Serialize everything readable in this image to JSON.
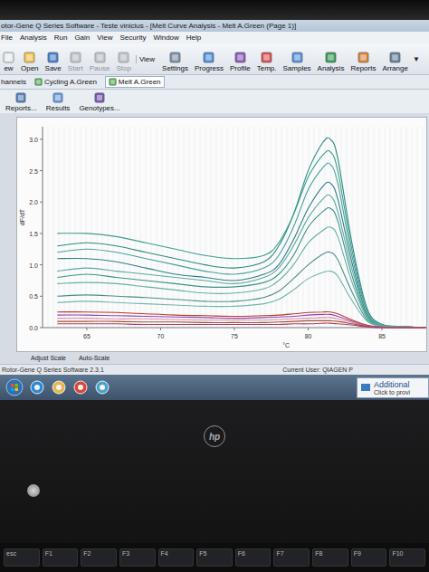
{
  "window": {
    "title": "otor-Gene Q Series Software - Teste vinicius - [Melt Curve Analysis - Melt A.Green (Page 1)]"
  },
  "menu": [
    "File",
    "Analysis",
    "Run",
    "Gain",
    "View",
    "Security",
    "Window",
    "Help"
  ],
  "toolbar": {
    "file_buttons": [
      {
        "label": "ew",
        "disabled": false
      },
      {
        "label": "Open",
        "disabled": false
      },
      {
        "label": "Save",
        "disabled": false
      },
      {
        "label": "Start",
        "disabled": true
      },
      {
        "label": "Pause",
        "disabled": true
      },
      {
        "label": "Stop",
        "disabled": true
      }
    ],
    "view_label": "View",
    "view_buttons": [
      "Settings",
      "Progress",
      "Profile",
      "Temp.",
      "Samples",
      "Analysis",
      "Reports",
      "Arrange"
    ],
    "more": "▼"
  },
  "channels": {
    "label": "hannels",
    "tabs": [
      {
        "label": "Cycling A.Green",
        "selected": false
      },
      {
        "label": "Melt A.Green",
        "selected": true
      }
    ]
  },
  "analysis_bar": [
    "Reports...",
    "Results",
    "Genotypes..."
  ],
  "chart": {
    "y_label": "dF/dT",
    "y_ticks": [
      "3.0",
      "2.5",
      "2.0",
      "1.5",
      "1.0",
      "0.5",
      "0.0"
    ],
    "x_ticks": [
      "65",
      "70",
      "75",
      "80",
      "85"
    ],
    "x_unit": "°C",
    "temperatures": [
      63,
      65,
      67,
      69,
      71,
      73,
      75,
      77,
      78,
      79,
      80,
      81,
      81.5,
      82,
      83,
      84,
      85,
      86,
      88
    ],
    "series": [
      {
        "color": "#2e8b7e",
        "values": [
          1.3,
          1.35,
          1.3,
          1.2,
          1.1,
          1.0,
          0.95,
          1.05,
          1.3,
          1.8,
          2.5,
          2.95,
          3.0,
          2.7,
          1.3,
          0.3,
          0.05,
          0.02,
          0.0
        ]
      },
      {
        "color": "#3aa08f",
        "values": [
          1.5,
          1.5,
          1.45,
          1.35,
          1.25,
          1.15,
          1.1,
          1.15,
          1.35,
          1.8,
          2.4,
          2.75,
          2.8,
          2.5,
          1.2,
          0.25,
          0.05,
          0.02,
          0.0
        ]
      },
      {
        "color": "#4a9fa0",
        "values": [
          1.2,
          1.25,
          1.2,
          1.1,
          1.0,
          0.9,
          0.85,
          0.95,
          1.15,
          1.6,
          2.2,
          2.55,
          2.6,
          2.3,
          1.1,
          0.25,
          0.05,
          0.02,
          0.0
        ]
      },
      {
        "color": "#2f7f86",
        "values": [
          1.1,
          1.1,
          1.05,
          0.95,
          0.85,
          0.8,
          0.75,
          0.85,
          1.0,
          1.4,
          1.9,
          2.25,
          2.3,
          2.05,
          1.0,
          0.2,
          0.04,
          0.02,
          0.0
        ]
      },
      {
        "color": "#5aa9a0",
        "values": [
          0.9,
          0.95,
          0.9,
          0.85,
          0.8,
          0.75,
          0.7,
          0.8,
          0.95,
          1.3,
          1.75,
          2.05,
          2.1,
          1.85,
          0.9,
          0.2,
          0.04,
          0.02,
          0.0
        ]
      },
      {
        "color": "#3d9488",
        "values": [
          0.8,
          0.85,
          0.8,
          0.75,
          0.7,
          0.65,
          0.65,
          0.72,
          0.85,
          1.15,
          1.6,
          1.85,
          1.9,
          1.7,
          0.8,
          0.18,
          0.03,
          0.01,
          0.0
        ]
      },
      {
        "color": "#62b0a6",
        "values": [
          0.7,
          0.72,
          0.7,
          0.65,
          0.6,
          0.55,
          0.55,
          0.62,
          0.75,
          1.0,
          1.35,
          1.55,
          1.6,
          1.45,
          0.7,
          0.15,
          0.03,
          0.01,
          0.0
        ]
      },
      {
        "color": "#4b8f8a",
        "values": [
          0.5,
          0.52,
          0.5,
          0.48,
          0.45,
          0.42,
          0.42,
          0.48,
          0.58,
          0.78,
          1.0,
          1.17,
          1.2,
          1.08,
          0.55,
          0.12,
          0.02,
          0.01,
          0.0
        ]
      },
      {
        "color": "#70b7ad",
        "values": [
          0.4,
          0.42,
          0.4,
          0.38,
          0.36,
          0.34,
          0.34,
          0.38,
          0.45,
          0.6,
          0.78,
          0.88,
          0.9,
          0.82,
          0.42,
          0.1,
          0.02,
          0.01,
          0.0
        ]
      },
      {
        "color": "#c0392b",
        "values": [
          0.25,
          0.25,
          0.24,
          0.22,
          0.2,
          0.19,
          0.18,
          0.19,
          0.2,
          0.22,
          0.24,
          0.25,
          0.25,
          0.22,
          0.12,
          0.04,
          0.01,
          0.0,
          0.0
        ]
      },
      {
        "color": "#8e44ad",
        "values": [
          0.2,
          0.2,
          0.19,
          0.18,
          0.17,
          0.16,
          0.15,
          0.16,
          0.17,
          0.18,
          0.2,
          0.21,
          0.21,
          0.18,
          0.1,
          0.03,
          0.01,
          0.0,
          0.0
        ]
      },
      {
        "color": "#d98cb3",
        "values": [
          0.15,
          0.15,
          0.14,
          0.14,
          0.13,
          0.12,
          0.12,
          0.12,
          0.13,
          0.14,
          0.15,
          0.16,
          0.16,
          0.14,
          0.08,
          0.02,
          0.0,
          0.0,
          0.0
        ]
      },
      {
        "color": "#a0522d",
        "values": [
          0.1,
          0.1,
          0.1,
          0.09,
          0.09,
          0.08,
          0.08,
          0.08,
          0.09,
          0.1,
          0.11,
          0.11,
          0.11,
          0.1,
          0.06,
          0.02,
          0.0,
          0.0,
          0.0
        ]
      },
      {
        "color": "#b03a6a",
        "values": [
          0.06,
          0.06,
          0.06,
          0.05,
          0.05,
          0.05,
          0.05,
          0.05,
          0.05,
          0.06,
          0.06,
          0.07,
          0.07,
          0.06,
          0.04,
          0.01,
          0.0,
          0.0,
          0.0
        ]
      }
    ]
  },
  "scale_buttons": [
    "Adjust Scale",
    "Auto-Scale"
  ],
  "status_bar": {
    "app": "Rotor-Gene Q Series Software 2.3.1",
    "user": "Current User: QIAGEN P"
  },
  "notification": {
    "title": "Additional",
    "text": "Click to provi"
  },
  "bezel": {
    "logo": "hp"
  },
  "keyboard": [
    "esc",
    "F1",
    "F2",
    "F3",
    "F4",
    "F5",
    "F6",
    "F7",
    "F8",
    "F9",
    "F10"
  ]
}
